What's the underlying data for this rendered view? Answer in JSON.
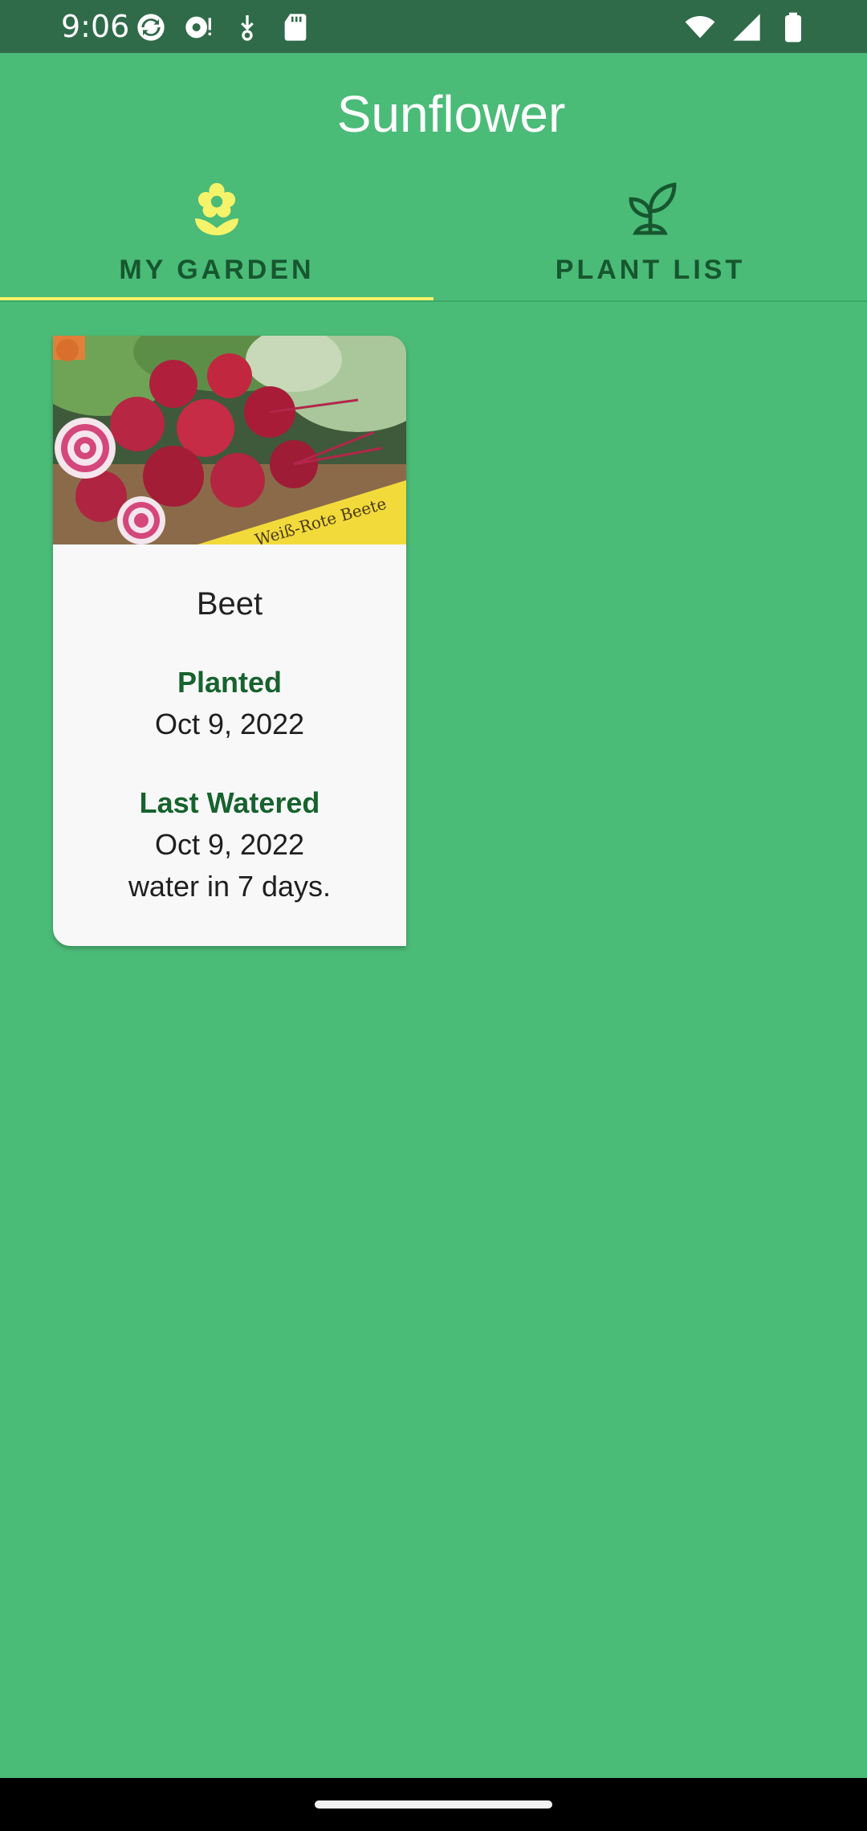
{
  "status_bar": {
    "time": "9:06",
    "left_icons": [
      "sync-icon",
      "media-icon",
      "download-icon",
      "sd-card-icon"
    ],
    "right_icons": [
      "wifi-icon",
      "cell-signal-icon",
      "battery-icon"
    ]
  },
  "app": {
    "title": "Sunflower"
  },
  "tabs": [
    {
      "label": "MY GARDEN",
      "icon": "flower-icon",
      "selected": true
    },
    {
      "label": "PLANT LIST",
      "icon": "sprout-icon",
      "selected": false
    }
  ],
  "garden": {
    "cards": [
      {
        "name": "Beet",
        "planted_label": "Planted",
        "planted_date": "Oct 9, 2022",
        "watered_label": "Last Watered",
        "watered_date": "Oct 9, 2022",
        "water_schedule": "water in 7 days.",
        "image_sign_text": "Weiß-Rote Beete"
      }
    ]
  },
  "colors": {
    "background": "#4BBB78",
    "status_bar": "#2F6B49",
    "tab_indicator": "#F4F36A",
    "label_green": "#17622E",
    "tab_label": "#16572F"
  }
}
